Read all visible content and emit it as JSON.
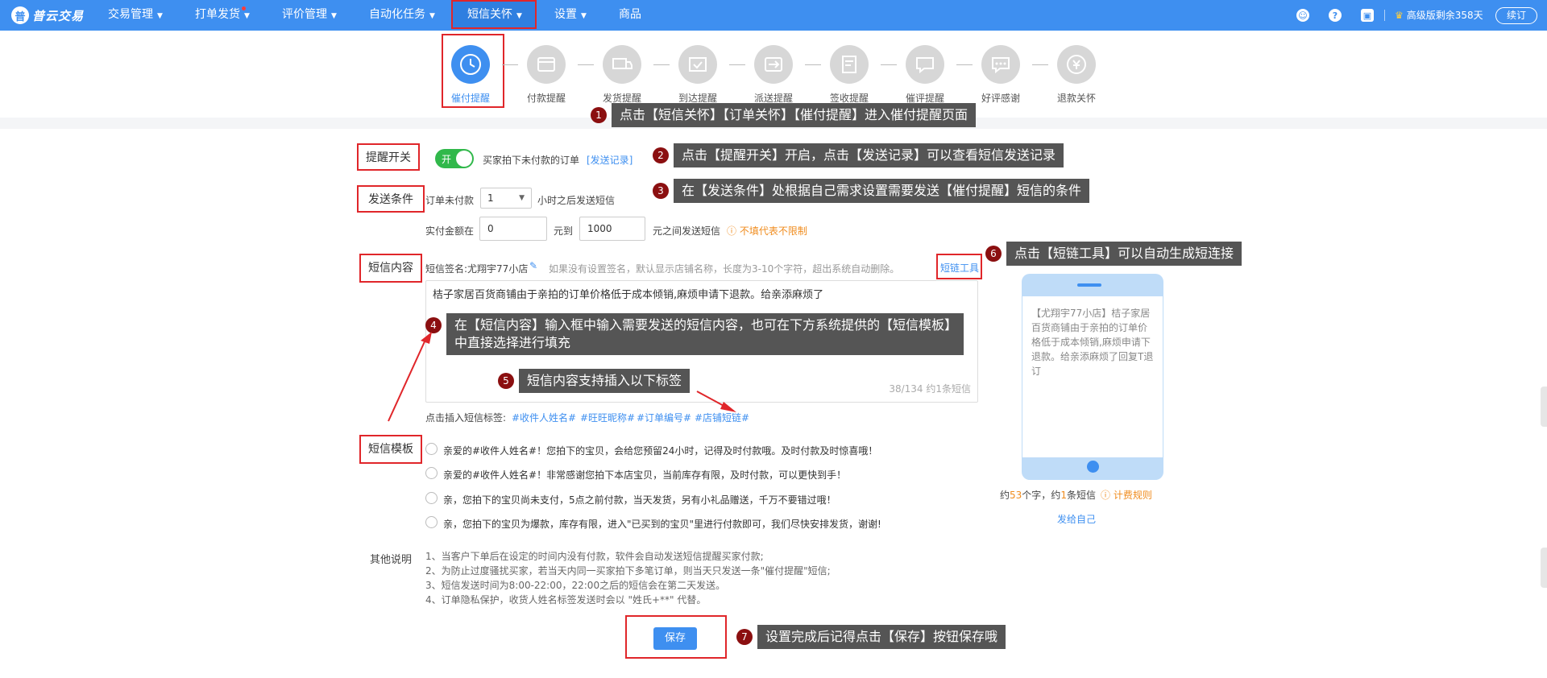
{
  "app": {
    "logo_text": "普云交易"
  },
  "nav": {
    "items": [
      {
        "label": "交易管理"
      },
      {
        "label": "打单发货"
      },
      {
        "label": "评价管理"
      },
      {
        "label": "自动化任务"
      },
      {
        "label": "短信关怀"
      },
      {
        "label": "设置"
      },
      {
        "label": "商品"
      }
    ],
    "vip_text": "高级版剩余358天",
    "renew_label": "续订"
  },
  "steps": [
    {
      "label": "催付提醒"
    },
    {
      "label": "付款提醒"
    },
    {
      "label": "发货提醒"
    },
    {
      "label": "到达提醒"
    },
    {
      "label": "派送提醒"
    },
    {
      "label": "签收提醒"
    },
    {
      "label": "催评提醒"
    },
    {
      "label": "好评感谢"
    },
    {
      "label": "退款关怀"
    }
  ],
  "annotations": [
    {
      "num": "1",
      "text": "点击【短信关怀】【订单关怀】【催付提醒】进入催付提醒页面"
    },
    {
      "num": "2",
      "text": "点击【提醒开关】开启，点击【发送记录】可以查看短信发送记录"
    },
    {
      "num": "3",
      "text": "在【发送条件】处根据自己需求设置需要发送【催付提醒】短信的条件"
    },
    {
      "num": "4",
      "text": "在【短信内容】输入框中输入需要发送的短信内容，也可在下方系统提供的【短信模板】中直接选择进行填充"
    },
    {
      "num": "5",
      "text": "短信内容支持插入以下标签"
    },
    {
      "num": "6",
      "text": "点击【短链工具】可以自动生成短连接"
    },
    {
      "num": "7",
      "text": "设置完成后记得点击【保存】按钮保存哦"
    }
  ],
  "form": {
    "switch_label": "提醒开关",
    "switch_on_text": "开",
    "switch_desc": "买家拍下未付款的订单",
    "send_record": "[发送记录]",
    "condition_label": "发送条件",
    "unpaid_prefix": "订单未付款",
    "hours_value": "1",
    "unpaid_suffix": "小时之后发送短信",
    "amount_prefix": "实付金额在",
    "amount_min": "0",
    "amount_mid": "元到",
    "amount_max": "1000",
    "amount_suffix": "元之间发送短信",
    "amount_hint": "不填代表不限制",
    "content_label": "短信内容",
    "signature": "短信签名:尤翔宇77小店",
    "signature_hint": "如果没有设置签名，默认显示店铺名称，长度为3-10个字符，超出系统自动删除。",
    "shortlink_tool": "短链工具",
    "content_text": "桔子家居百货商铺由于亲拍的订单价格低于成本倾销,麻烦申请下退款。给亲添麻烦了",
    "counter": "38/134  约1条短信",
    "tags_prefix": "点击插入短信标签:",
    "tags": [
      "#收件人姓名#",
      "#旺旺昵称#",
      "#订单编号#",
      "#店铺短链#"
    ],
    "template_label": "短信模板",
    "templates": [
      "亲爱的#收件人姓名#！您拍下的宝贝，会给您预留24小时，记得及时付款哦。及时付款及时惊喜哦！",
      "亲爱的#收件人姓名#！非常感谢您拍下本店宝贝，当前库存有限，及时付款，可以更快到手！",
      "亲，您拍下的宝贝尚未支付，5点之前付款，当天发货，另有小礼品赠送，千万不要错过哦！",
      "亲，您拍下的宝贝为爆款，库存有限，进入\"已买到的宝贝\"里进行付款即可，我们尽快安排发货，谢谢!"
    ],
    "notes_label": "其他说明",
    "notes": [
      "1、当客户下单后在设定的时间内没有付款，软件会自动发送短信提醒买家付款;",
      "2、为防止过度骚扰买家，若当天内同一买家拍下多笔订单，则当天只发送一条\"催付提醒\"短信;",
      "3、短信发送时间为8:00-22:00，22:00之后的短信会在第二天发送。",
      "4、订单隐私保护，收货人姓名标签发送时会以 \"姓氏+**\" 代替。"
    ],
    "save_label": "保存"
  },
  "preview": {
    "message": "【尤翔宇77小店】桔子家居百货商铺由于亲拍的订单价格低于成本倾销,麻烦申请下退款。给亲添麻烦了回复T退订",
    "count_prefix": "约",
    "count_chars": "53",
    "count_mid": "个字，约",
    "count_sms": "1",
    "count_suffix": "条短信",
    "billing_rule": "计费规则",
    "send_self": "发给自己"
  },
  "colors": {
    "primary": "#3e8ff0",
    "highlight": "#e0262a",
    "annotation_num": "#8b0f10",
    "switch_on": "#31b84b",
    "hint": "#f08c1e"
  }
}
